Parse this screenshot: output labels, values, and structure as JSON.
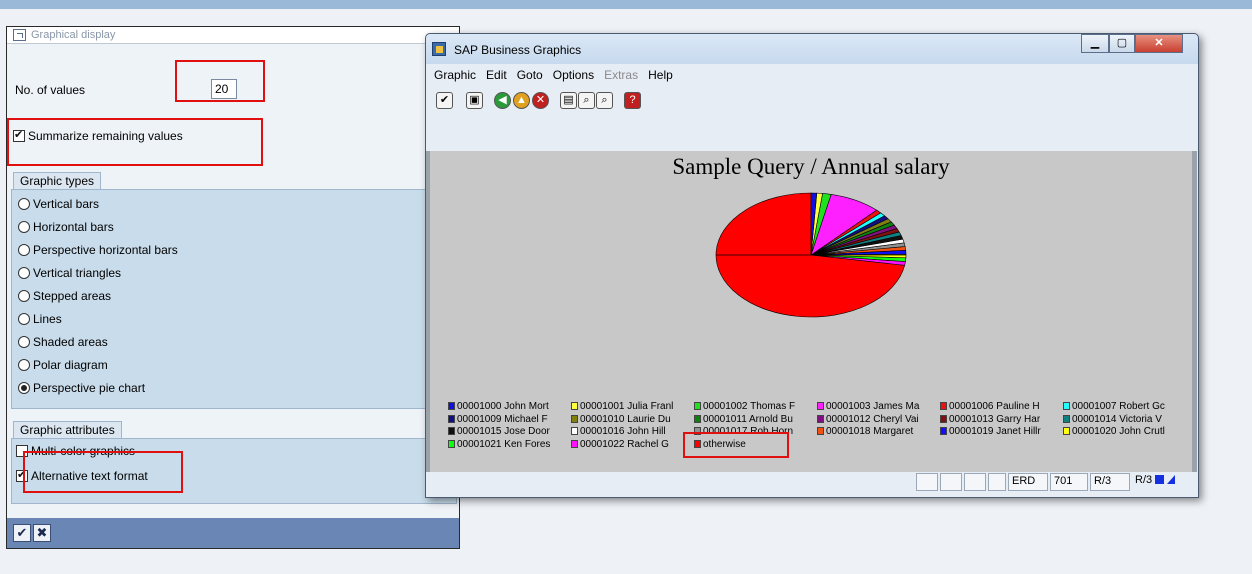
{
  "dialog": {
    "title": "Graphical display",
    "values_label": "No. of values",
    "values_value": "20",
    "summarize_label": "Summarize remaining values",
    "summarize_checked": true,
    "graphic_types_title": "Graphic types",
    "graphic_types": [
      {
        "label": "Vertical bars",
        "selected": false
      },
      {
        "label": "Horizontal bars",
        "selected": false
      },
      {
        "label": "Perspective horizontal bars",
        "selected": false
      },
      {
        "label": "Vertical triangles",
        "selected": false
      },
      {
        "label": "Stepped areas",
        "selected": false
      },
      {
        "label": "Lines",
        "selected": false
      },
      {
        "label": "Shaded areas",
        "selected": false
      },
      {
        "label": "Polar diagram",
        "selected": false
      },
      {
        "label": "Perspective pie chart",
        "selected": true
      }
    ],
    "graphic_attributes_title": "Graphic attributes",
    "multicolor_label": "Multi-color graphics",
    "multicolor_checked": false,
    "alt_text_label": "Alternative text format",
    "alt_text_checked": true,
    "ok_icon": "check-icon",
    "cancel_icon": "cancel-icon"
  },
  "window": {
    "title": "SAP Business Graphics",
    "menu": [
      {
        "label": "Graphic",
        "enabled": true
      },
      {
        "label": "Edit",
        "enabled": true
      },
      {
        "label": "Goto",
        "enabled": true
      },
      {
        "label": "Options",
        "enabled": true
      },
      {
        "label": "Extras",
        "enabled": false
      },
      {
        "label": "Help",
        "enabled": true
      }
    ],
    "controls": [
      "minimize-icon",
      "maximize-icon",
      "close-icon"
    ],
    "toolbar_icons": [
      "confirm-icon",
      "save-icon",
      "back-icon",
      "exit-icon",
      "cancel-icon",
      "print-icon",
      "find-icon",
      "find-next-icon",
      "help-icon"
    ],
    "status": {
      "sys": "ERD",
      "client": "701",
      "r1": "R/3",
      "r2": "R/3"
    }
  },
  "chart_data": {
    "type": "pie",
    "title": "Sample Query / Annual salary",
    "legend_position": "bottom",
    "slices": [
      {
        "label": "00001000 John Mort",
        "color": "#1010e0",
        "value": 1.0
      },
      {
        "label": "00001001 Julia Franl",
        "color": "#ffff40",
        "value": 1.0
      },
      {
        "label": "00001002 Thomas F",
        "color": "#20e020",
        "value": 1.5
      },
      {
        "label": "00001003 James Ma",
        "color": "#ff20ff",
        "value": 9.0
      },
      {
        "label": "00001006 Pauline H",
        "color": "#ee1010",
        "value": 1.0
      },
      {
        "label": "00001007 Robert Gc",
        "color": "#20ffff",
        "value": 1.0
      },
      {
        "label": "00001009 Michael F",
        "color": "#101080",
        "value": 1.0
      },
      {
        "label": "00001010 Laurie Du",
        "color": "#808010",
        "value": 1.0
      },
      {
        "label": "00001011 Arnold Bu",
        "color": "#108010",
        "value": 1.0
      },
      {
        "label": "00001012 Cheryl Vai",
        "color": "#801080",
        "value": 1.0
      },
      {
        "label": "00001013 Garry Har",
        "color": "#801010",
        "value": 1.0
      },
      {
        "label": "00001014 Victoria V",
        "color": "#108080",
        "value": 1.0
      },
      {
        "label": "00001015 Jose Door",
        "color": "#101010",
        "value": 1.0
      },
      {
        "label": "00001016 John Hill",
        "color": "#ffffff",
        "value": 1.0
      },
      {
        "label": "00001017 Rob Horn",
        "color": "#909090",
        "value": 1.0
      },
      {
        "label": "00001018 Margaret",
        "color": "#f05010",
        "value": 1.0
      },
      {
        "label": "00001019 Janet Hillr",
        "color": "#1010ff",
        "value": 1.0
      },
      {
        "label": "00001020 John Crutl",
        "color": "#ffff10",
        "value": 1.0
      },
      {
        "label": "00001021 Ken Fores",
        "color": "#10ff10",
        "value": 1.0
      },
      {
        "label": "00001022 Rachel G",
        "color": "#ff10ff",
        "value": 1.0
      },
      {
        "label": "otherwise",
        "color": "#ff0000",
        "value": 74.5
      }
    ]
  }
}
